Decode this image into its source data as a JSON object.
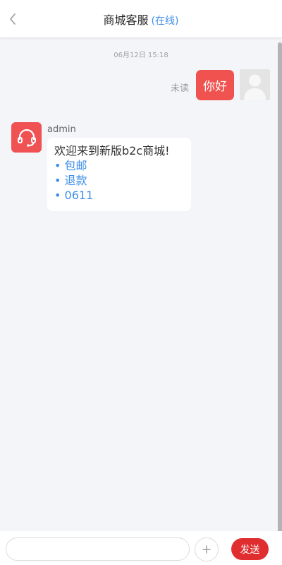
{
  "header": {
    "title": "商城客服",
    "status": "(在线)"
  },
  "chat": {
    "timestamp": "06月12日 15:18",
    "messages": [
      {
        "sender": "me",
        "status": "未读",
        "text": "你好"
      },
      {
        "sender": "agent",
        "name": "admin",
        "text": "欢迎来到新版b2c商城!",
        "links": [
          "包邮",
          "退款",
          "0611"
        ]
      }
    ]
  },
  "footer": {
    "input_placeholder": "",
    "send_label": "发送"
  },
  "colors": {
    "accent": "#f0524f",
    "send": "#e02e30",
    "link": "#3e8ee8",
    "background": "#f4f5f9"
  },
  "icons": {
    "back": "chevron-left-icon",
    "agent_avatar": "headset-icon",
    "user_avatar": "user-silhouette-icon",
    "attach": "plus-icon"
  }
}
